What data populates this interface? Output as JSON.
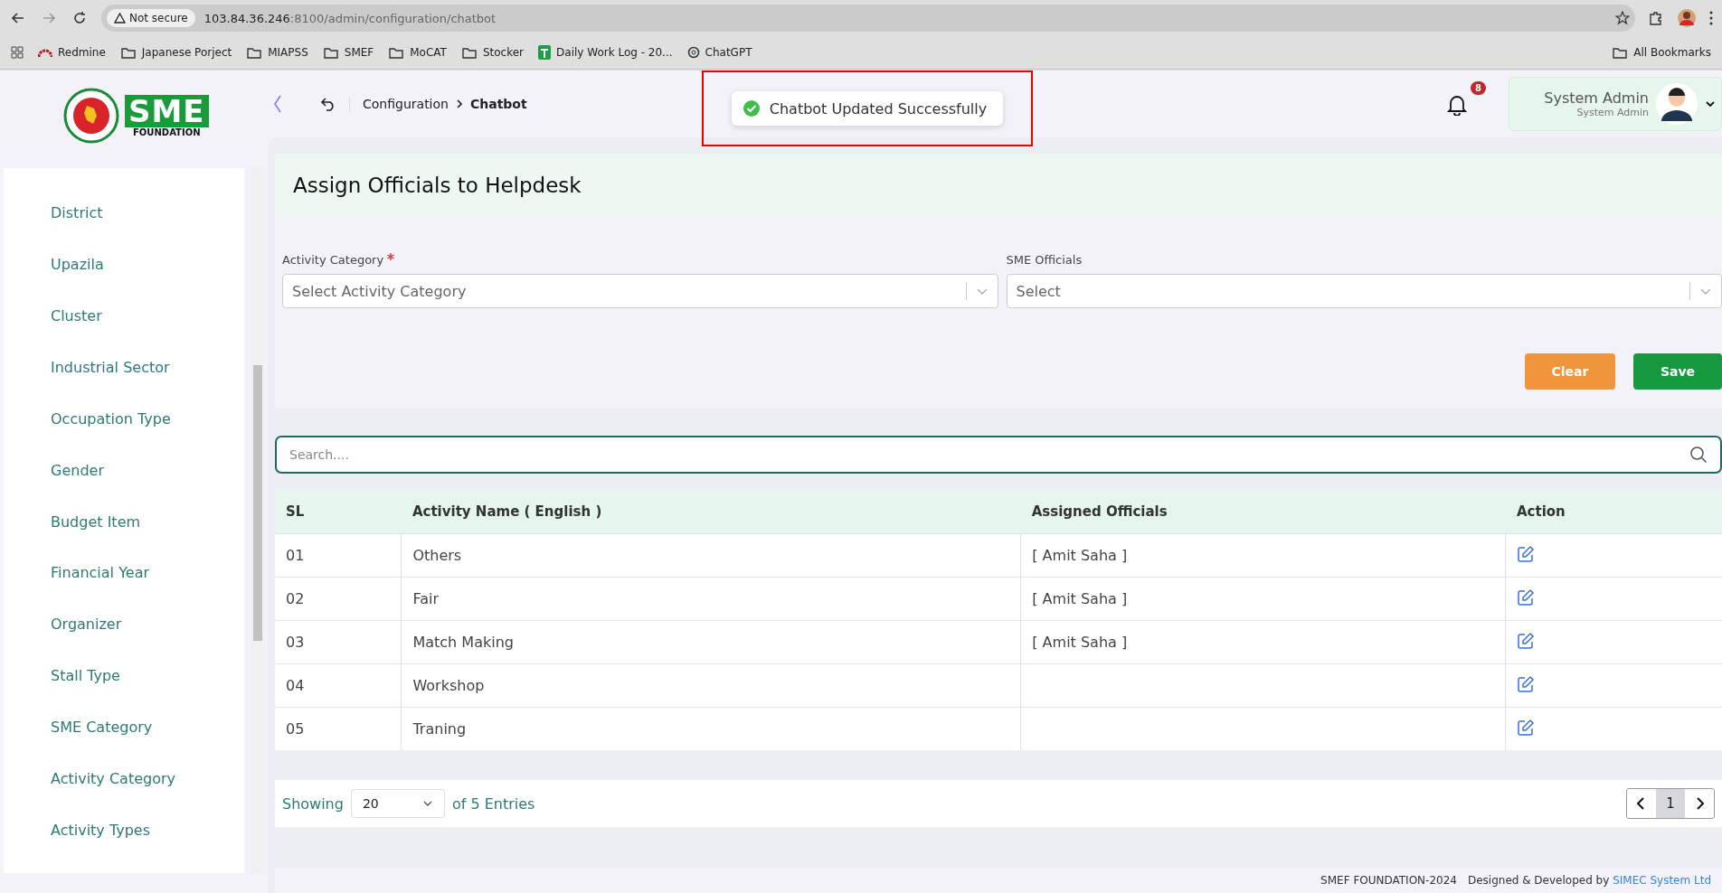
{
  "browser": {
    "security": "Not secure",
    "url_host": "103.84.36.246",
    "url_rest": ":8100/admin/configuration/chatbot",
    "bookmarks": [
      {
        "label": "Redmine",
        "kind": "redmine"
      },
      {
        "label": "Japanese Porject",
        "kind": "folder"
      },
      {
        "label": "MIAPSS",
        "kind": "folder"
      },
      {
        "label": "SMEF",
        "kind": "folder"
      },
      {
        "label": "MoCAT",
        "kind": "folder"
      },
      {
        "label": "Stocker",
        "kind": "folder"
      },
      {
        "label": "Daily Work Log - 20...",
        "kind": "sheet"
      },
      {
        "label": "ChatGPT",
        "kind": "chatgpt"
      }
    ],
    "all_bookmarks": "All Bookmarks"
  },
  "header": {
    "logo_letters": "SME",
    "logo_caption": "FOUNDATION",
    "breadcrumb": [
      {
        "label": "Configuration",
        "current": false
      },
      {
        "label": "Chatbot",
        "current": true
      }
    ],
    "toast": "Chatbot Updated Successfully",
    "notifications": "8",
    "user": {
      "name": "System Admin",
      "role": "System Admin"
    }
  },
  "sidebar": {
    "items": [
      "District",
      "Upazila",
      "Cluster",
      "Industrial Sector",
      "Occupation Type",
      "Gender",
      "Budget Item",
      "Financial Year",
      "Organizer",
      "Stall Type",
      "SME Category",
      "Activity Category",
      "Activity Types"
    ]
  },
  "form": {
    "title": "Assign Officials to Helpdesk",
    "fields": [
      {
        "label": "Activity Category",
        "required": true,
        "placeholder": "Select Activity Category"
      },
      {
        "label": "SME Officials",
        "required": false,
        "placeholder": "Select"
      }
    ],
    "buttons": [
      {
        "label": "Clear",
        "kind": "clear"
      },
      {
        "label": "Save",
        "kind": "save"
      }
    ]
  },
  "search": {
    "placeholder": "Search...."
  },
  "table": {
    "columns": [
      "SL",
      "Activity Name ( English )",
      "Assigned Officials",
      "Action"
    ],
    "rows": [
      {
        "sl": "01",
        "name": "Others",
        "officials": "[ Amit Saha ]"
      },
      {
        "sl": "02",
        "name": "Fair",
        "officials": "[ Amit Saha ]"
      },
      {
        "sl": "03",
        "name": "Match Making",
        "officials": "[ Amit Saha ]"
      },
      {
        "sl": "04",
        "name": "Workshop"
      },
      {
        "sl": "05",
        "name": "Traning"
      }
    ]
  },
  "pagination": {
    "showing": "Showing",
    "page_size": "20",
    "entries": "of 5 Entries",
    "pages": [
      {
        "label": "1",
        "selected": true
      }
    ]
  },
  "footer": {
    "copyright": "SMEF FOUNDATION-2024",
    "designed": "Designed & Developed by",
    "company": "SIMEC System Ltd"
  }
}
